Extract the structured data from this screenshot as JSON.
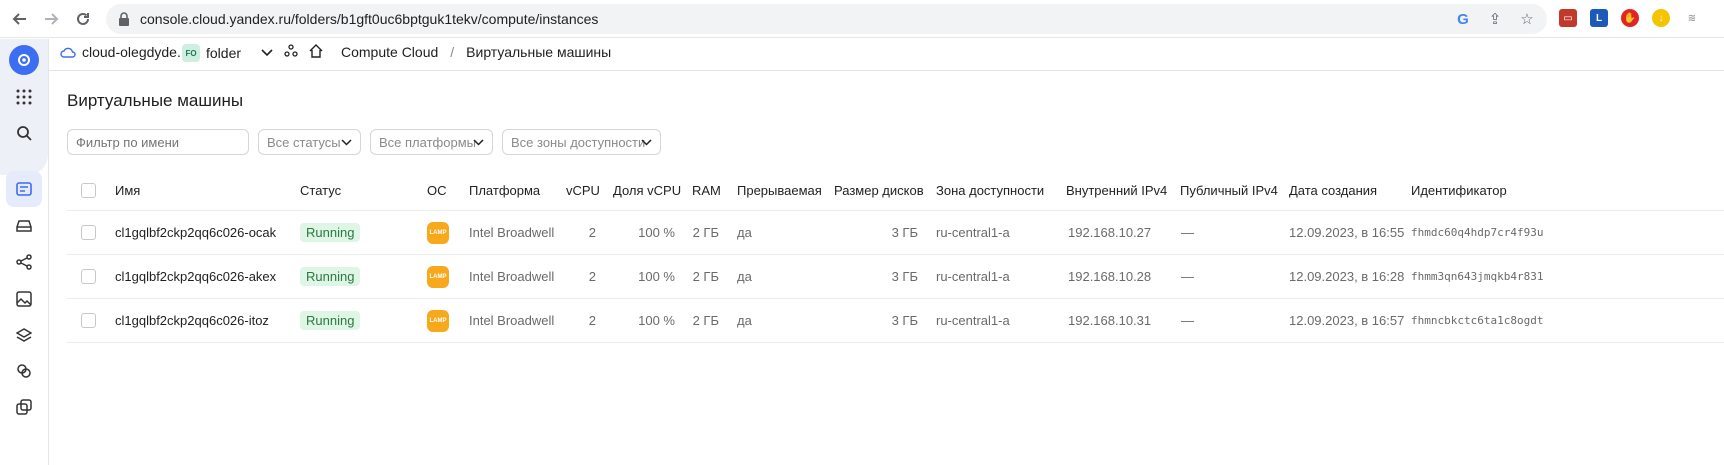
{
  "browser": {
    "url": "console.cloud.yandex.ru/folders/b1gft0uc6bptguk1tekv/compute/instances",
    "icons": [
      "back-arrow-icon",
      "forward-arrow-icon",
      "reload-icon",
      "lock-icon",
      "google-icon",
      "share-icon",
      "star-icon"
    ],
    "extensions": [
      {
        "name": "screen-extension-icon",
        "color": "#c0392b",
        "glyph": "▭"
      },
      {
        "name": "lastpass-extension-icon",
        "color": "#1c59b8",
        "glyph": "L"
      },
      {
        "name": "adblock-extension-icon",
        "color": "#e32424",
        "glyph": "✋"
      },
      {
        "name": "download-extension-icon",
        "color": "#f5c400",
        "glyph": "↓"
      },
      {
        "name": "audio-extension-icon",
        "color": "#9e9e9e",
        "glyph": "≋"
      }
    ]
  },
  "header": {
    "cloud": "cloud-olegdyde...",
    "folder_badge": "FO",
    "folder": "folder",
    "service": "Compute Cloud",
    "separator": "/",
    "page": "Виртуальные машины"
  },
  "main": {
    "title": "Виртуальные машины",
    "filters": {
      "name_placeholder": "Фильтр по имени",
      "status": "Все статусы",
      "platform": "Все платформы",
      "zone": "Все зоны доступности"
    },
    "columns": [
      "Имя",
      "Статус",
      "ОС",
      "Платформа",
      "vCPU",
      "Доля vCPU",
      "RAM",
      "Прерываемая",
      "Размер дисков",
      "Зона доступности",
      "Внутренний IPv4",
      "Публичный IPv4",
      "Дата создания",
      "Идентификатор"
    ],
    "rows": [
      {
        "name": "cl1gqlbf2ckp2qq6c026-ocak",
        "status": "Running",
        "os": "LAMP",
        "platform": "Intel Broadwell",
        "vcpu": "2",
        "vcpu_share": "100 %",
        "ram": "2 ГБ",
        "preemptible": "да",
        "disk": "3 ГБ",
        "zone": "ru-central1-a",
        "ipv4": "192.168.10.27",
        "public_ipv4": "—",
        "created": "12.09.2023, в 16:55",
        "id": "fhmdc60q4hdp7cr4f93u"
      },
      {
        "name": "cl1gqlbf2ckp2qq6c026-akex",
        "status": "Running",
        "os": "LAMP",
        "platform": "Intel Broadwell",
        "vcpu": "2",
        "vcpu_share": "100 %",
        "ram": "2 ГБ",
        "preemptible": "да",
        "disk": "3 ГБ",
        "zone": "ru-central1-a",
        "ipv4": "192.168.10.28",
        "public_ipv4": "—",
        "created": "12.09.2023, в 16:28",
        "id": "fhmm3qn643jmqkb4r831"
      },
      {
        "name": "cl1gqlbf2ckp2qq6c026-itoz",
        "status": "Running",
        "os": "LAMP",
        "platform": "Intel Broadwell",
        "vcpu": "2",
        "vcpu_share": "100 %",
        "ram": "2 ГБ",
        "preemptible": "да",
        "disk": "3 ГБ",
        "zone": "ru-central1-a",
        "ipv4": "192.168.10.31",
        "public_ipv4": "—",
        "created": "12.09.2023, в 16:57",
        "id": "fhmncbkctc6ta1c8ogdt"
      }
    ]
  },
  "rail": {
    "icons": [
      "cloud-logo-icon",
      "apps-grid-icon",
      "search-icon",
      "compute-icon",
      "disk-icon",
      "network-icon",
      "image-icon",
      "layers-icon",
      "instance-groups-icon",
      "snapshots-icon"
    ]
  },
  "colors": {
    "accent": "#3d6df2",
    "status_running_bg": "#dff5e6",
    "status_running_text": "#2b7a3f",
    "os_badge": "#f7a81b"
  }
}
